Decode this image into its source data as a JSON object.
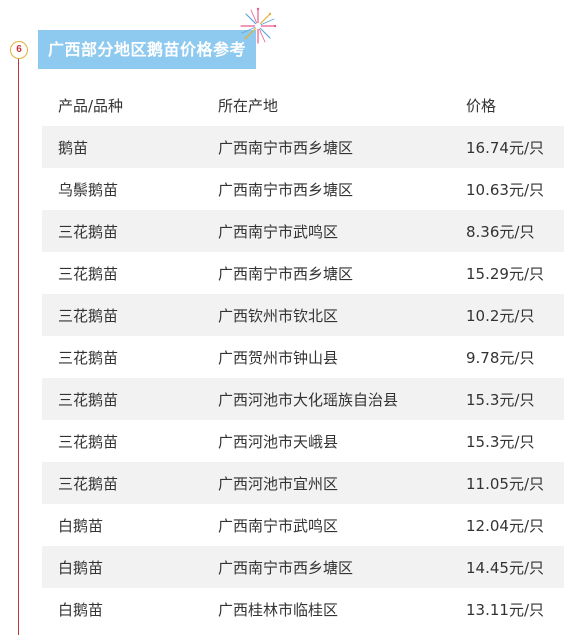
{
  "section": {
    "step_number": "6",
    "title": "广西部分地区鹅苗价格参考"
  },
  "table": {
    "headers": [
      "产品/品种",
      "所在产地",
      "价格"
    ],
    "rows": [
      [
        "鹅苗",
        "广西南宁市西乡塘区",
        "16.74元/只"
      ],
      [
        "乌鬃鹅苗",
        "广西南宁市西乡塘区",
        "10.63元/只"
      ],
      [
        "三花鹅苗",
        "广西南宁市武鸣区",
        "8.36元/只"
      ],
      [
        "三花鹅苗",
        "广西南宁市西乡塘区",
        "15.29元/只"
      ],
      [
        "三花鹅苗",
        "广西钦州市钦北区",
        "10.2元/只"
      ],
      [
        "三花鹅苗",
        "广西贺州市钟山县",
        "9.78元/只"
      ],
      [
        "三花鹅苗",
        "广西河池市大化瑶族自治县",
        "15.3元/只"
      ],
      [
        "三花鹅苗",
        "广西河池市天峨县",
        "15.3元/只"
      ],
      [
        "三花鹅苗",
        "广西河池市宜州区",
        "11.05元/只"
      ],
      [
        "白鹅苗",
        "广西南宁市武鸣区",
        "12.04元/只"
      ],
      [
        "白鹅苗",
        "广西南宁市西乡塘区",
        "14.45元/只"
      ],
      [
        "白鹅苗",
        "广西桂林市临桂区",
        "13.11元/只"
      ]
    ]
  },
  "colors": {
    "title_bg": "#8ec9ef",
    "timeline": "#c8343b",
    "badge_border": "#e0b23a",
    "row_stripe": "#f2f2f2"
  },
  "icons": {
    "decoration": "firework-icon"
  }
}
